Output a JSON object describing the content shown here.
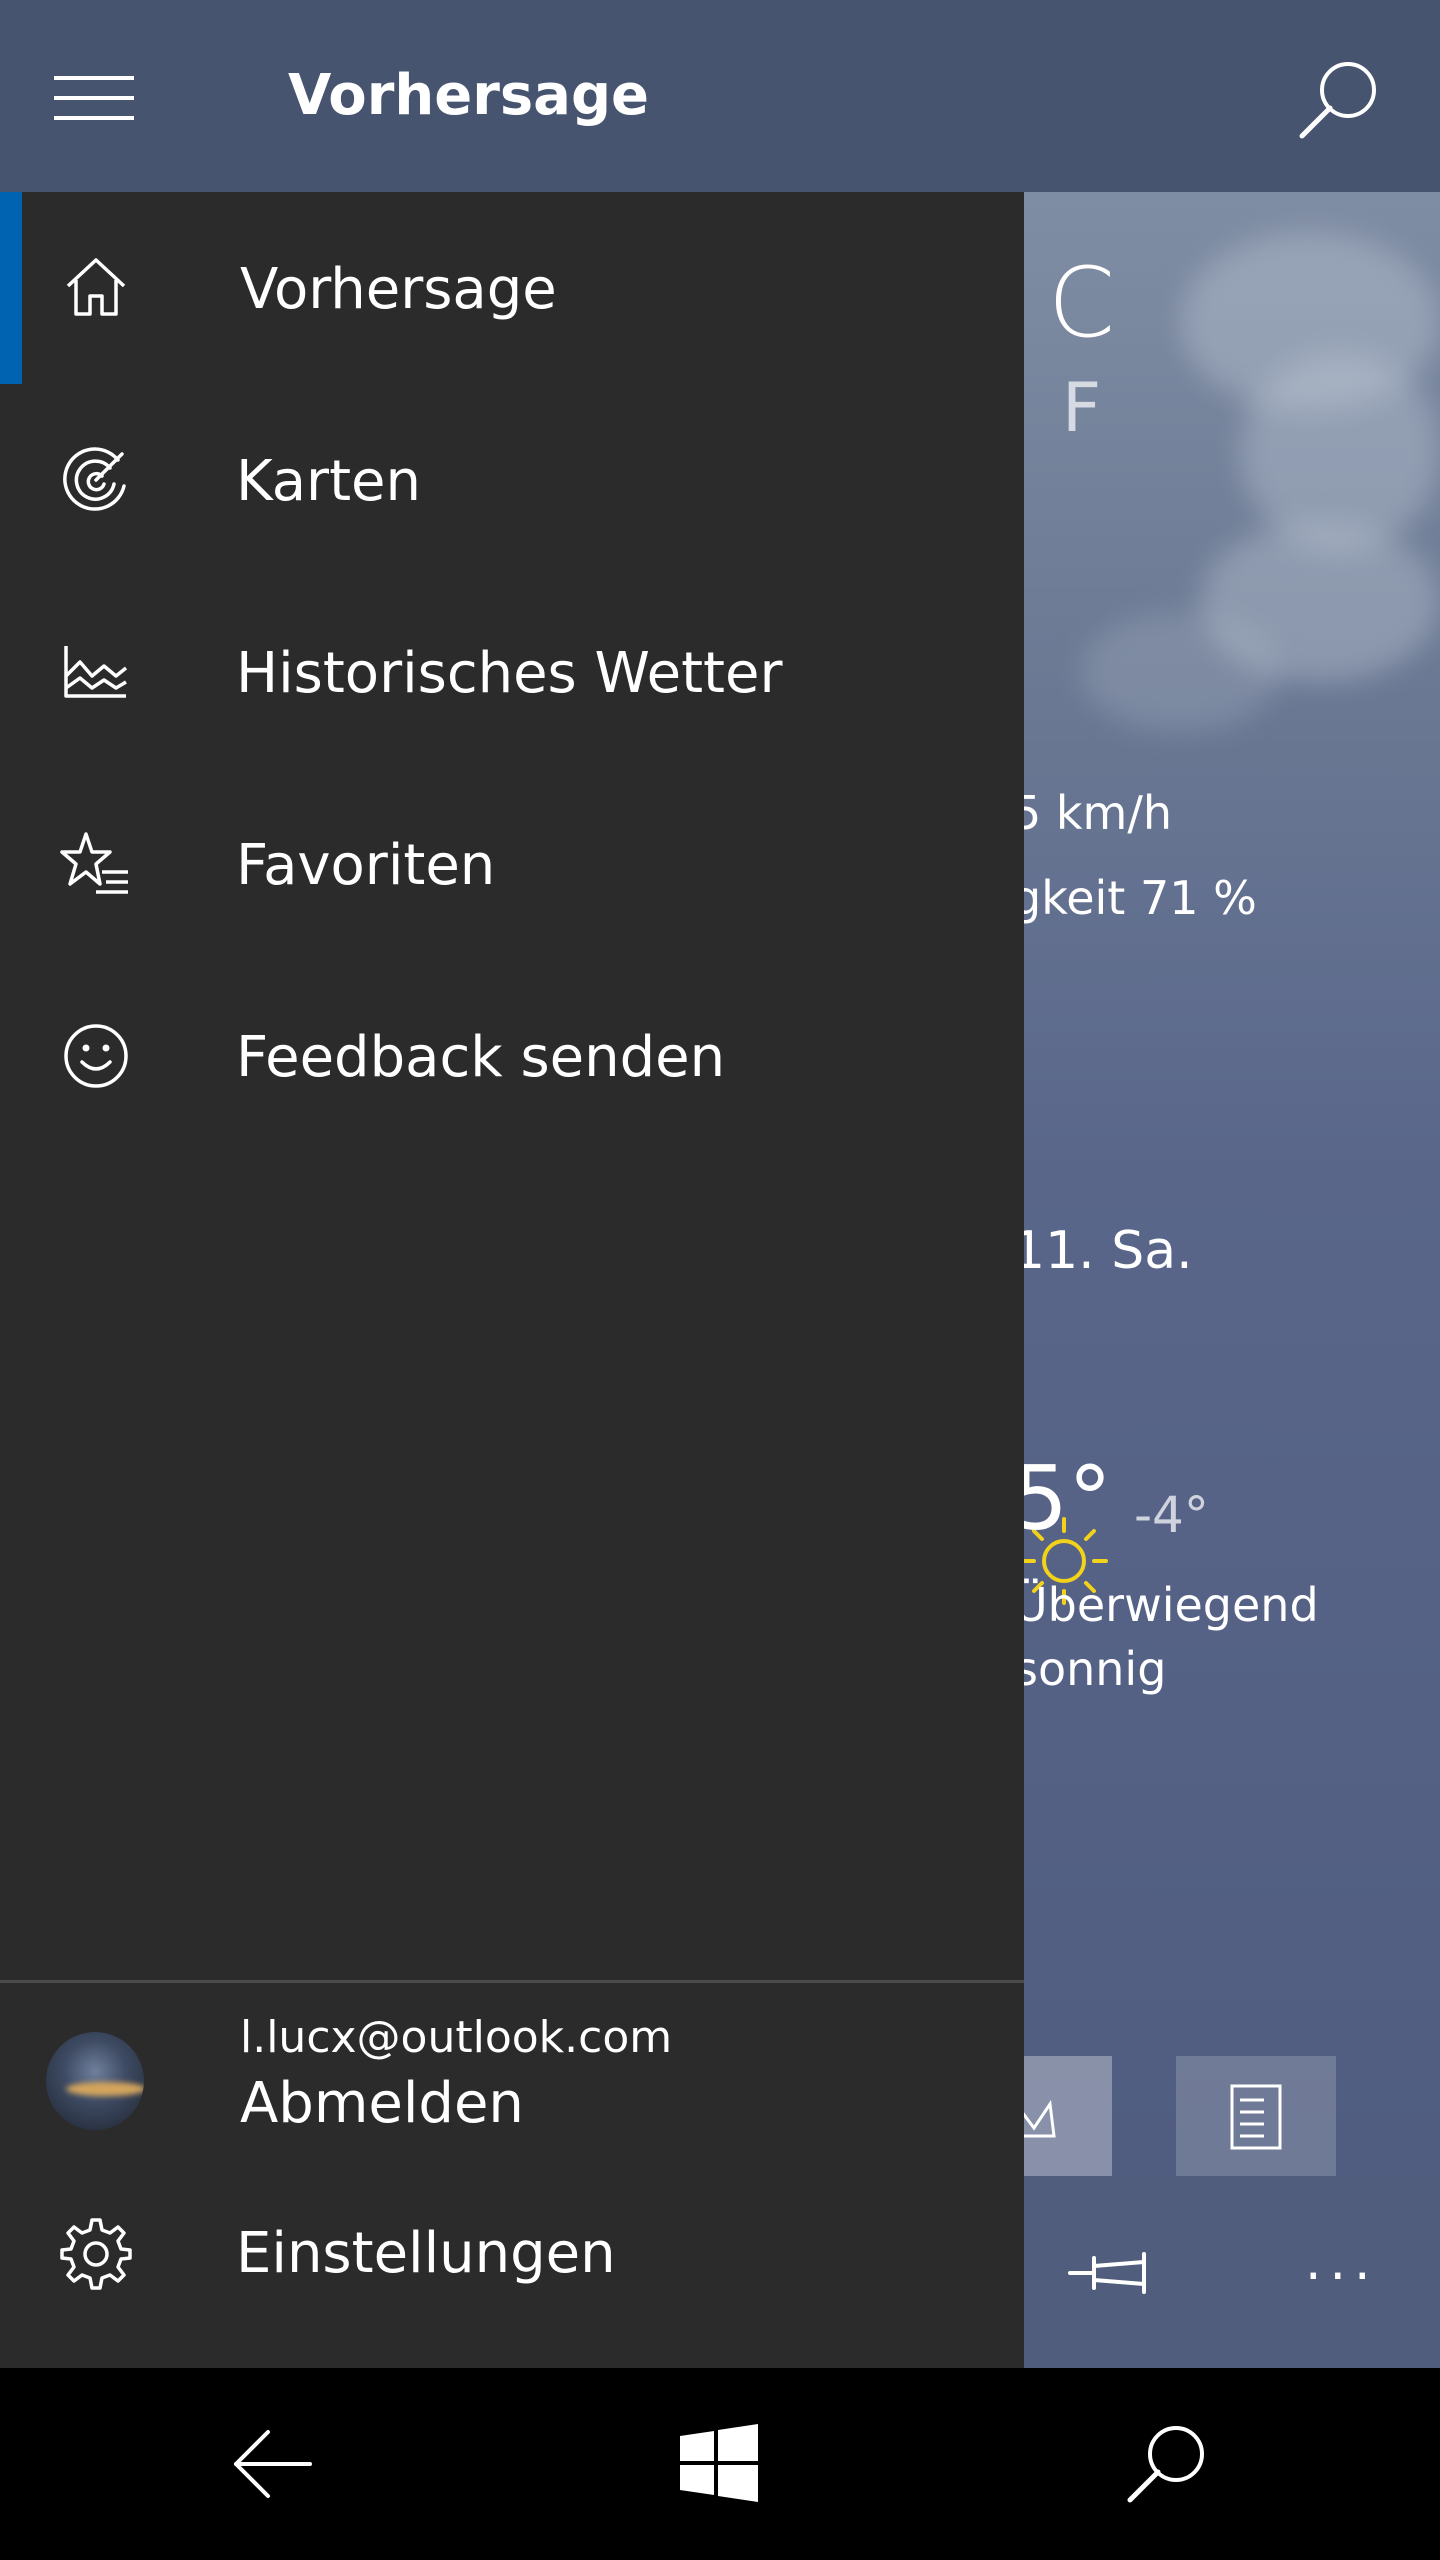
{
  "header": {
    "title": "Vorhersage",
    "menu_icon": "hamburger-menu-icon",
    "search_icon": "search-icon"
  },
  "drawer": {
    "items": [
      {
        "label": "Vorhersage",
        "icon": "home-icon",
        "selected": true
      },
      {
        "label": "Karten",
        "icon": "radar-icon",
        "selected": false
      },
      {
        "label": "Historisches Wetter",
        "icon": "history-chart-icon",
        "selected": false
      },
      {
        "label": "Favoriten",
        "icon": "favorites-star-list-icon",
        "selected": false
      },
      {
        "label": "Feedback senden",
        "icon": "smiley-icon",
        "selected": false
      }
    ],
    "account": {
      "email": "l.lucx@outlook.com",
      "action": "Abmelden"
    },
    "settings": {
      "label": "Einstellungen",
      "icon": "gear-icon"
    },
    "accent_color": "#0063b1"
  },
  "weather": {
    "unit_celsius": "C",
    "unit_fahrenheit": "F",
    "wind": "5 km/h",
    "humidity": "gkeit   71 %",
    "day_label": "11. Sa.",
    "high": "5°",
    "low": "-4°",
    "condition": "Überwiegend sonnig"
  },
  "appbar": {
    "pin_icon": "pin-icon",
    "more_label": "..."
  },
  "system_bar": {
    "back_icon": "back-arrow-icon",
    "start_icon": "windows-logo-icon",
    "search_icon": "search-icon"
  }
}
